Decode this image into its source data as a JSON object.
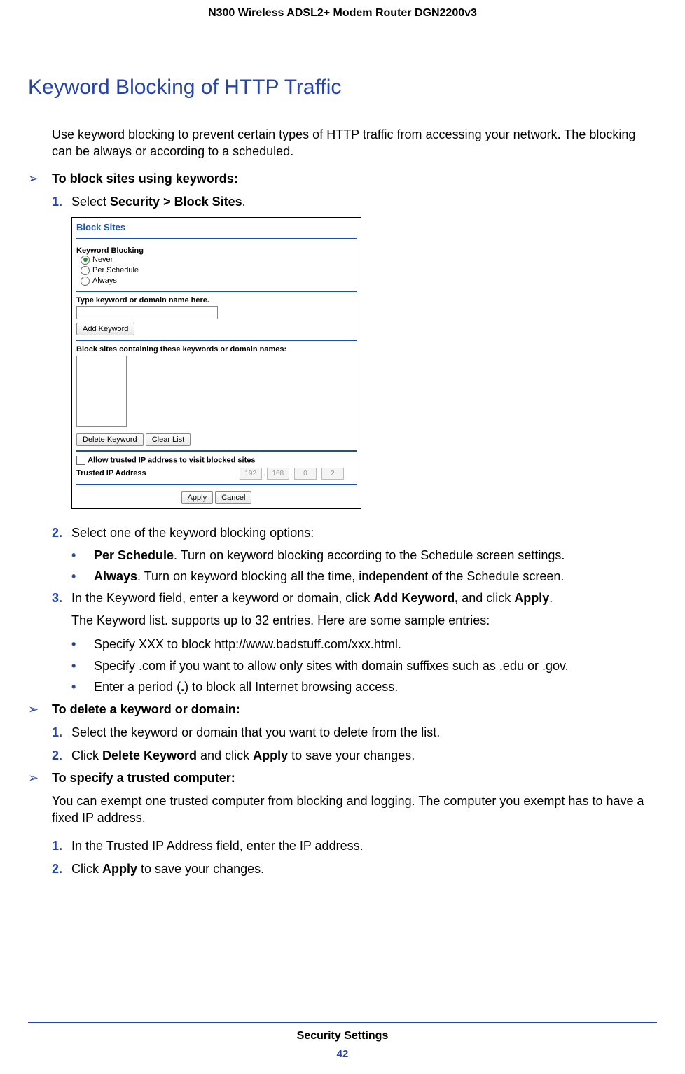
{
  "doc_header": "N300 Wireless ADSL2+ Modem Router DGN2200v3",
  "title": "Keyword Blocking of HTTP Traffic",
  "intro": "Use keyword blocking to prevent certain types of HTTP traffic from accessing your network. The blocking can be always or according to a scheduled.",
  "proc1_title": "To block sites using keywords:",
  "proc1": {
    "step1_pre": "Select ",
    "step1_bold": "Security > Block Sites",
    "step1_post": "."
  },
  "ui": {
    "title": "Block Sites",
    "kb_label": "Keyword Blocking",
    "opt_never": "Never",
    "opt_sched": "Per Schedule",
    "opt_always": "Always",
    "type_label": "Type keyword or domain name here.",
    "add_btn": "Add Keyword",
    "block_label": "Block sites containing these keywords or domain names:",
    "del_btn": "Delete Keyword",
    "clear_btn": "Clear List",
    "allow_label": "Allow trusted IP address to visit blocked sites",
    "trusted_label": "Trusted IP Address",
    "ip": [
      "192",
      "168",
      "0",
      "2"
    ],
    "apply_btn": "Apply",
    "cancel_btn": "Cancel"
  },
  "step2_text": "Select one of the keyword blocking options:",
  "step2_b1_bold": "Per Schedule",
  "step2_b1_rest": ". Turn on keyword blocking according to the Schedule screen settings.",
  "step2_b2_bold": "Always",
  "step2_b2_rest": ". Turn on keyword blocking all the time, independent of the Schedule screen.",
  "step3_pre": "In the Keyword field, enter a keyword or domain, click ",
  "step3_b1": "Add Keyword,",
  "step3_mid": " and click ",
  "step3_b2": "Apply",
  "step3_post": ".",
  "step3_follow": "The Keyword list. supports up to 32 entries. Here are some sample entries:",
  "step3_bul1": "Specify XXX to block http://www.badstuff.com/xxx.html.",
  "step3_bul2": "Specify .com if you want to allow only sites with domain suffixes such as .edu or .gov.",
  "step3_bul3_pre": "Enter a period (",
  "step3_bul3_bold": ".",
  "step3_bul3_post": ") to block all Internet browsing access.",
  "proc2_title": "To delete a keyword or domain:",
  "proc2": {
    "s1": "Select the keyword or domain that you want to delete from the list.",
    "s2_pre": "Click ",
    "s2_b1": "Delete Keyword",
    "s2_mid": " and click ",
    "s2_b2": "Apply",
    "s2_post": " to save your changes."
  },
  "proc3_title": "To specify a trusted computer:",
  "proc3_intro": "You can exempt one trusted computer from blocking and logging. The computer you exempt has to have a fixed IP address.",
  "proc3": {
    "s1": "In the Trusted IP Address field, enter the IP address.",
    "s2_pre": "Click ",
    "s2_b": "Apply",
    "s2_post": " to save your changes."
  },
  "footer_title": "Security Settings",
  "footer_page": "42"
}
